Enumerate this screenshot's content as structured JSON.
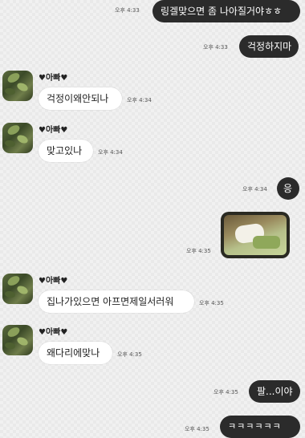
{
  "chat": {
    "m1": {
      "text": "링겔맞으면 좀 나아질거야ㅎㅎ",
      "time": "오후 4:33"
    },
    "m2": {
      "text": "걱정하지마",
      "time": "오후 4:33"
    },
    "m3": {
      "sender": "♥아빠♥",
      "text": "걱정이왜안되나",
      "time": "오후 4:34"
    },
    "m4": {
      "sender": "♥아빠♥",
      "text": "맞고있나",
      "time": "오후 4:34"
    },
    "m5": {
      "text": "응",
      "time": "오후 4:34"
    },
    "m6": {
      "time": "오후 4:35"
    },
    "m7": {
      "sender": "♥아빠♥",
      "text": "집나가있으면 아프면제일서러워",
      "time": "오후 4:35"
    },
    "m8": {
      "sender": "♥아빠♥",
      "text": "왜다리에맞나",
      "time": "오후 4:35"
    },
    "m9": {
      "text": "팔...이야",
      "time": "오후 4:35"
    },
    "m10": {
      "text": "ㅋㅋㅋㅋㅋㅋ",
      "time": "오후 4:35"
    }
  }
}
